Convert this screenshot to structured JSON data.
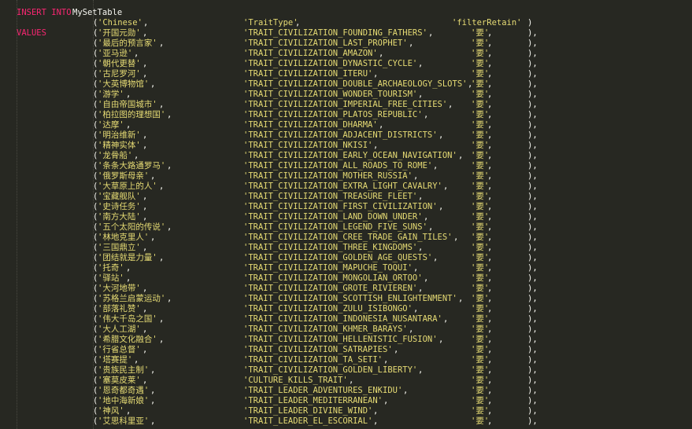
{
  "editor": {
    "theme_colors": {
      "background": "#272822",
      "keyword": "#f92672",
      "string": "#e6db74",
      "text": "#f8f8f2"
    },
    "header": {
      "keyword_insert": "INSERT INTO",
      "table_name": "MySetTable",
      "keyword_values": "VALUES"
    },
    "columns": {
      "col1": "'Chinese'",
      "col2": "'TraitType'",
      "col3": "'filterRetain'"
    },
    "rows": [
      {
        "name": "'开国元勋'",
        "trait": "'TRAIT_CIVILIZATION_FOUNDING_FATHERS'",
        "keep": "'要'"
      },
      {
        "name": "'最后的预言家'",
        "trait": "'TRAIT_CIVILIZATION_LAST_PROPHET'",
        "keep": "'要'"
      },
      {
        "name": "'亚马逊'",
        "trait": "'TRAIT_CIVILIZATION_AMAZON'",
        "keep": "'要'"
      },
      {
        "name": "'朝代更替'",
        "trait": "'TRAIT_CIVILIZATION_DYNASTIC_CYCLE'",
        "keep": "'要'"
      },
      {
        "name": "'古尼罗河'",
        "trait": "'TRAIT_CIVILIZATION_ITERU'",
        "keep": "'要'"
      },
      {
        "name": "'大英博物馆'",
        "trait": "'TRAIT_CIVILIZATION_DOUBLE_ARCHAEOLOGY_SLOTS'",
        "keep": "'要'"
      },
      {
        "name": "'游学'",
        "trait": "'TRAIT_CIVILIZATION_WONDER_TOURISM'",
        "keep": "'要'"
      },
      {
        "name": "'自由帝国城市'",
        "trait": "'TRAIT_CIVILIZATION_IMPERIAL_FREE_CITIES'",
        "keep": "'要'"
      },
      {
        "name": "'柏拉图的理想国'",
        "trait": "'TRAIT_CIVILIZATION_PLATOS_REPUBLIC'",
        "keep": "'要'"
      },
      {
        "name": "'达摩'",
        "trait": "'TRAIT_CIVILIZATION_DHARMA'",
        "keep": "'要'"
      },
      {
        "name": "'明治维新'",
        "trait": "'TRAIT_CIVILIZATION_ADJACENT_DISTRICTS'",
        "keep": "'要'"
      },
      {
        "name": "'精神实体'",
        "trait": "'TRAIT_CIVILIZATION_NKISI'",
        "keep": "'要'"
      },
      {
        "name": "'龙骨船'",
        "trait": "'TRAIT_CIVILIZATION_EARLY_OCEAN_NAVIGATION'",
        "keep": "'要'"
      },
      {
        "name": "'条条大路通罗马'",
        "trait": "'TRAIT_CIVILIZATION_ALL_ROADS_TO_ROME'",
        "keep": "'要'"
      },
      {
        "name": "'俄罗斯母亲'",
        "trait": "'TRAIT_CIVILIZATION_MOTHER_RUSSIA'",
        "keep": "'要'"
      },
      {
        "name": "'大草原上的人'",
        "trait": "'TRAIT_CIVILIZATION_EXTRA_LIGHT_CAVALRY'",
        "keep": "'要'"
      },
      {
        "name": "'宝藏舰队'",
        "trait": "'TRAIT_CIVILIZATION_TREASURE_FLEET'",
        "keep": "'要'"
      },
      {
        "name": "'史诗任务'",
        "trait": "'TRAIT_CIVILIZATION_FIRST_CIVILIZATION'",
        "keep": "'要'"
      },
      {
        "name": "'南方大陆'",
        "trait": "'TRAIT_CIVILIZATION_LAND_DOWN_UNDER'",
        "keep": "'要'"
      },
      {
        "name": "'五个太阳的传说'",
        "trait": "'TRAIT_CIVILIZATION_LEGEND_FIVE_SUNS'",
        "keep": "'要'"
      },
      {
        "name": "'林地克里人'",
        "trait": "'TRAIT_CIVILIZATION_CREE_TRADE_GAIN_TILES'",
        "keep": "'要'"
      },
      {
        "name": "'三国鼎立'",
        "trait": "'TRAIT_CIVILIZATION_THREE_KINGDOMS'",
        "keep": "'要'"
      },
      {
        "name": "'团结就是力量'",
        "trait": "'TRAIT_CIVILIZATION_GOLDEN_AGE_QUESTS'",
        "keep": "'要'"
      },
      {
        "name": "'托奇'",
        "trait": "'TRAIT_CIVILIZATION_MAPUCHE_TOQUI'",
        "keep": "'要'"
      },
      {
        "name": "'驿站'",
        "trait": "'TRAIT_CIVILIZATION_MONGOLIAN_ORTOO'",
        "keep": "'要'"
      },
      {
        "name": "'大河地带'",
        "trait": "'TRAIT_CIVILIZATION_GROTE_RIVIEREN'",
        "keep": "'要'"
      },
      {
        "name": "'苏格兰启蒙运动'",
        "trait": "'TRAIT_CIVILIZATION_SCOTTISH_ENLIGHTENMENT'",
        "keep": "'要'"
      },
      {
        "name": "'部落礼赞'",
        "trait": "'TRAIT_CIVILIZATION_ZULU_ISIBONGO'",
        "keep": "'要'"
      },
      {
        "name": "'伟大千岛之国'",
        "trait": "'TRAIT_CIVILIZATION_INDONESIA_NUSANTARA'",
        "keep": "'要'"
      },
      {
        "name": "'大人工湖'",
        "trait": "'TRAIT_CIVILIZATION_KHMER_BARAYS'",
        "keep": "'要'"
      },
      {
        "name": "'希腊文化融合'",
        "trait": "'TRAIT_CIVILIZATION_HELLENISTIC_FUSION'",
        "keep": "'要'"
      },
      {
        "name": "'行省总督'",
        "trait": "'TRAIT_CIVILIZATION_SATRAPIES'",
        "keep": "'要'"
      },
      {
        "name": "'塔赛提'",
        "trait": "'TRAIT_CIVILIZATION_TA_SETI'",
        "keep": "'要'"
      },
      {
        "name": "'贵族民主制'",
        "trait": "'TRAIT_CIVILIZATION_GOLDEN_LIBERTY'",
        "keep": "'要'"
      },
      {
        "name": "'塞莫皮莱'",
        "trait": "'CULTURE_KILLS_TRAIT'",
        "keep": "'要'"
      },
      {
        "name": "'恩奇都奇遇'",
        "trait": "'TRAIT_LEADER_ADVENTURES_ENKIDU'",
        "keep": "'要'"
      },
      {
        "name": "'地中海新娘'",
        "trait": "'TRAIT_LEADER_MEDITERRANEAN'",
        "keep": "'要'"
      },
      {
        "name": "'神风'",
        "trait": "'TRAIT_LEADER_DIVINE_WIND'",
        "keep": "'要'"
      },
      {
        "name": "'艾思科里亚'",
        "trait": "'TRAIT_LEADER_EL_ESCORIAL'",
        "keep": "'要'"
      }
    ]
  }
}
